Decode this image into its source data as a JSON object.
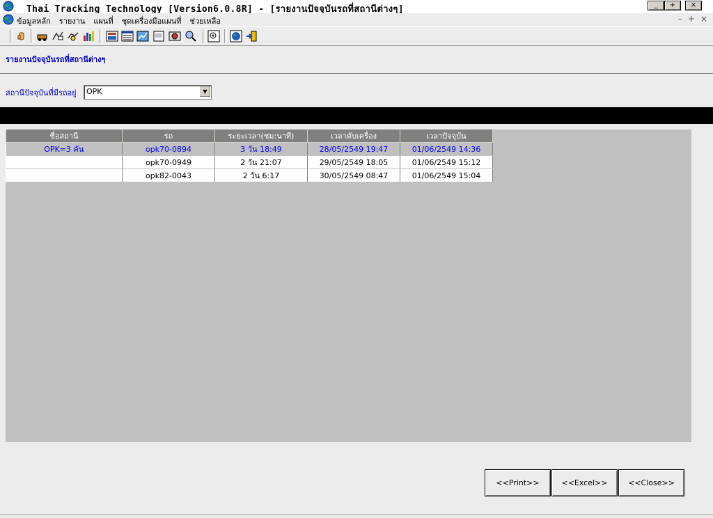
{
  "window": {
    "title": "Thai Tracking Technology [Version6.0.8R] - [รายงานปัจจุบันรถที่สถานีต่างๆ]",
    "caption_buttons": [
      "_",
      "+",
      "×"
    ]
  },
  "menu": {
    "items": [
      "ข้อมูลหลัก",
      "รายงาน",
      "แผนที่",
      "ชุดเครื่องมือแผนที่",
      "ช่วยเหลือ"
    ],
    "mdi_controls": [
      "–",
      "+",
      "×"
    ]
  },
  "toolbar": {
    "icons": [
      "hand-icon",
      "vehicle-icon",
      "route-icon",
      "car-search-icon",
      "chart-icon",
      "map-icon",
      "list-icon",
      "report-chart-icon",
      "document-icon",
      "photo-icon",
      "find-icon",
      "zoom-icon",
      "globe-icon",
      "exit-icon"
    ]
  },
  "report": {
    "title": "รายงานปัจจุบันรถที่สถานีต่างๆ"
  },
  "filter": {
    "label": "สถานีปัจจุบันที่มีรถอยู่",
    "selected": "OPK"
  },
  "grid": {
    "columns": [
      "ชื่อสถานี",
      "รถ",
      "ระยะเวลา(ชม:นาที)",
      "เวลาดับเครื่อง",
      "เวลาปัจจุบัน"
    ],
    "rows": [
      [
        "OPK=3 คัน",
        "opk70-0894",
        "3 วัน  18:49",
        "28/05/2549 19:47",
        "01/06/2549 14:36"
      ],
      [
        "",
        "opk70-0949",
        "2 วัน  21:07",
        "29/05/2549 18:05",
        "01/06/2549 15:12"
      ],
      [
        "",
        "opk82-0043",
        "2 วัน  6:17",
        "30/05/2549 08:47",
        "01/06/2549 15:04"
      ]
    ]
  },
  "buttons": {
    "print": "<<Print>>",
    "excel": "<<Excel>>",
    "close": "<<Close>>"
  }
}
